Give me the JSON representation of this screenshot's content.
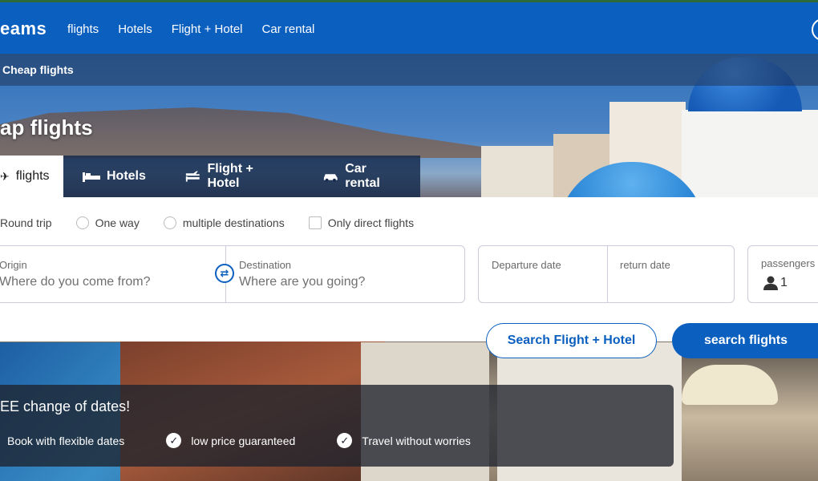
{
  "header": {
    "brand": "eams",
    "nav": [
      "flights",
      "Hotels",
      "Flight + Hotel",
      "Car rental"
    ]
  },
  "breadcrumb": "Cheap flights",
  "hero": {
    "title": "ap flights"
  },
  "tabs": [
    {
      "label": "flights",
      "icon": "plane-icon"
    },
    {
      "label": "Hotels",
      "icon": "bed-icon"
    },
    {
      "label": "Flight + Hotel",
      "icon": "plane-bed-icon"
    },
    {
      "label": "Car rental",
      "icon": "car-icon"
    }
  ],
  "trip_options": {
    "round_trip": "Round trip",
    "one_way": "One way",
    "multiple": "multiple destinations",
    "direct": "Only direct flights"
  },
  "origin": {
    "label": "Origin",
    "placeholder": "Where do you come from?"
  },
  "destination": {
    "label": "Destination",
    "placeholder": "Where are you going?"
  },
  "dates": {
    "departure_label": "Departure date",
    "return_label": "return date"
  },
  "passengers": {
    "label": "passengers",
    "count": "1"
  },
  "buttons": {
    "flight_hotel": "Search Flight + Hotel",
    "search": "search flights"
  },
  "promo": {
    "title": "EE change of dates!",
    "items": [
      "Book with flexible dates",
      "low price guaranteed",
      "Travel without worries"
    ]
  },
  "colors": {
    "brand_blue": "#0a5fbf",
    "promo_bg": "#1e222d"
  }
}
